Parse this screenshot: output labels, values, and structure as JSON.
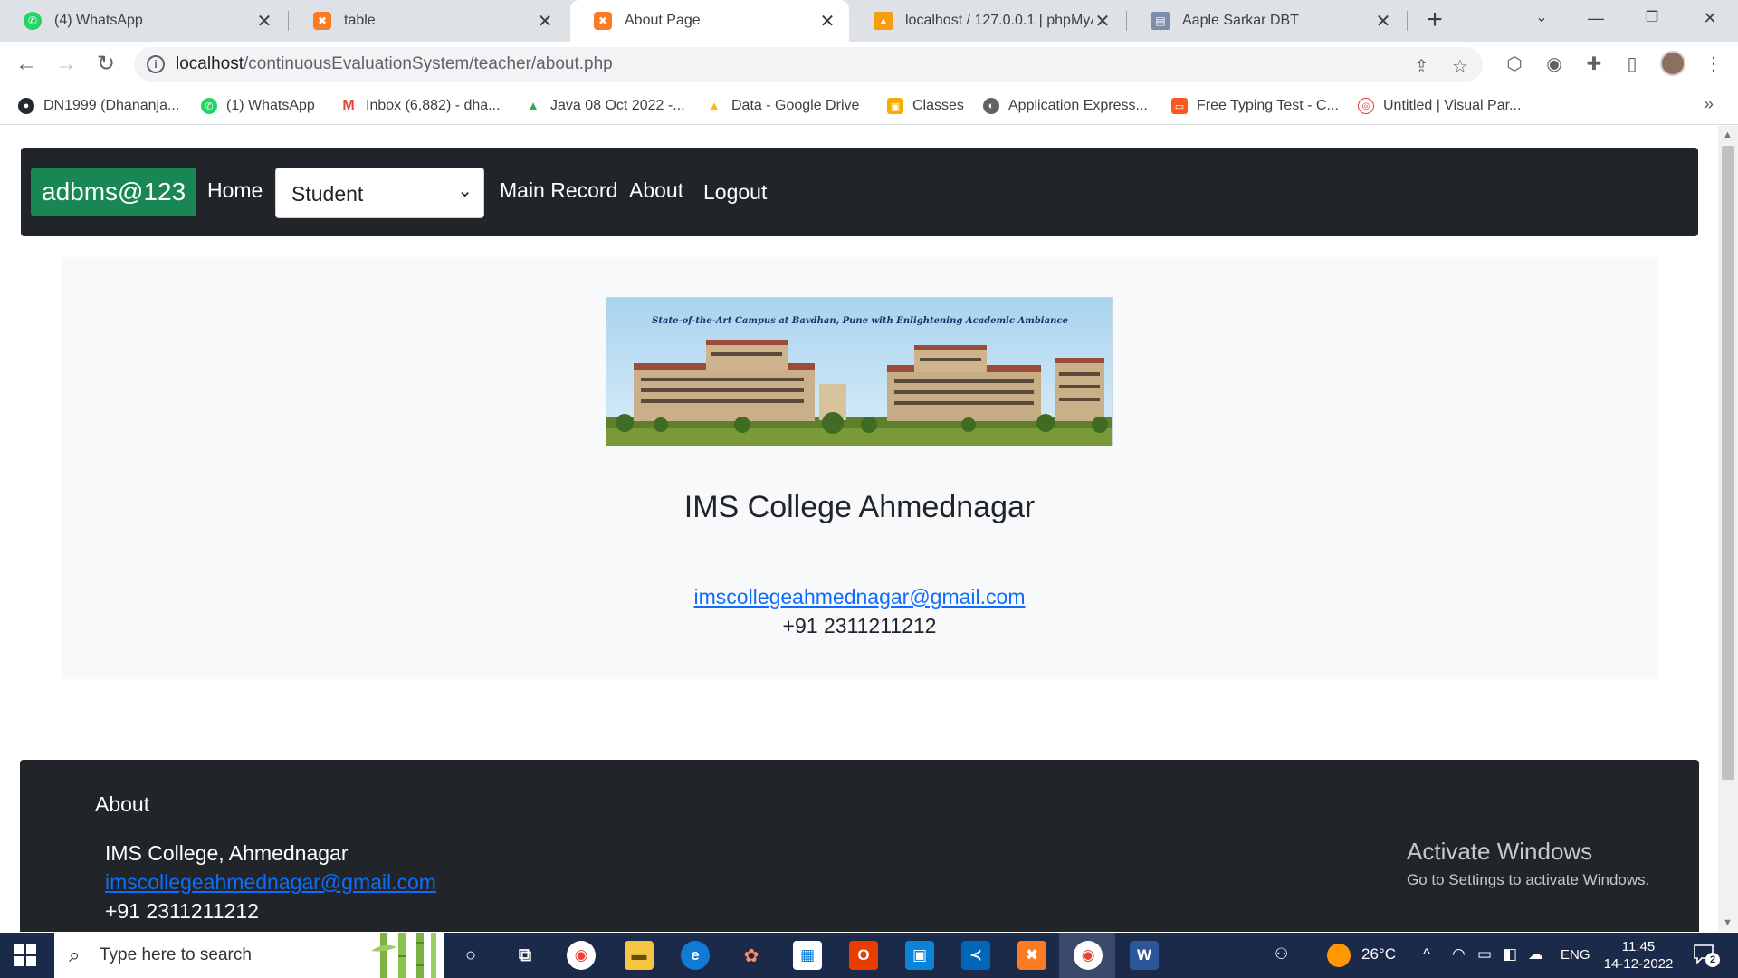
{
  "browser": {
    "tabs": [
      {
        "title": "(4) WhatsApp",
        "icon": "whatsapp-icon",
        "color": "#25d366"
      },
      {
        "title": "table",
        "icon": "xampp-icon",
        "color": "#fb7a24"
      },
      {
        "title": "About Page",
        "icon": "xampp-icon",
        "color": "#fb7a24",
        "active": true
      },
      {
        "title": "localhost / 127.0.0.1 | phpMyA",
        "icon": "phpmyadmin-icon",
        "color": "#f89c0e"
      },
      {
        "title": "Aaple Sarkar DBT",
        "icon": "document-icon",
        "color": "#7b8da8"
      }
    ],
    "url_host": "localhost",
    "url_path": "/continuousEvaluationSystem/teacher/about.php",
    "bookmarks": [
      {
        "label": "DN1999 (Dhananja...",
        "icon": "github-icon",
        "color": "#24292f"
      },
      {
        "label": "(1) WhatsApp",
        "icon": "whatsapp-icon",
        "color": "#25d366"
      },
      {
        "label": "Inbox (6,882) - dha...",
        "icon": "gmail-icon",
        "color": "#ea4335"
      },
      {
        "label": "Java 08 Oct 2022 -...",
        "icon": "google-drive-icon",
        "color": "#fbbc04"
      },
      {
        "label": "Data - Google Drive",
        "icon": "google-drive-icon",
        "color": "#fbbc04"
      },
      {
        "label": "Classes",
        "icon": "classroom-icon",
        "color": "#f9ab00"
      },
      {
        "label": "Application Express...",
        "icon": "apex-icon",
        "color": "#5f6368"
      },
      {
        "label": "Free Typing Test - C...",
        "icon": "typing-icon",
        "color": "#ff5722"
      },
      {
        "label": "Untitled | Visual Par...",
        "icon": "visual-paradigm-icon",
        "color": "#e53935"
      }
    ]
  },
  "site": {
    "brand": "adbms@123",
    "nav": {
      "home": "Home",
      "role_selected": "Student",
      "main_record": "Main Record",
      "about": "About",
      "logout": "Logout"
    },
    "about": {
      "banner_caption": "State-of-the-Art Campus at Bavdhan, Pune with Enlightening Academic Ambiance",
      "college_name": "IMS College Ahmednagar",
      "email": "imscollegeahmednagar@gmail.com",
      "phone": "+91 2311211212"
    },
    "footer": {
      "heading": "About",
      "name": "IMS College, Ahmednagar",
      "email": "imscollegeahmednagar@gmail.com",
      "phone": "+91 2311211212"
    }
  },
  "watermark": {
    "line1": "Activate Windows",
    "line2": "Go to Settings to activate Windows."
  },
  "taskbar": {
    "search_placeholder": "Type here to search",
    "weather": "26°C",
    "language": "ENG",
    "time": "11:45",
    "date": "14-12-2022",
    "notifications": "2"
  }
}
